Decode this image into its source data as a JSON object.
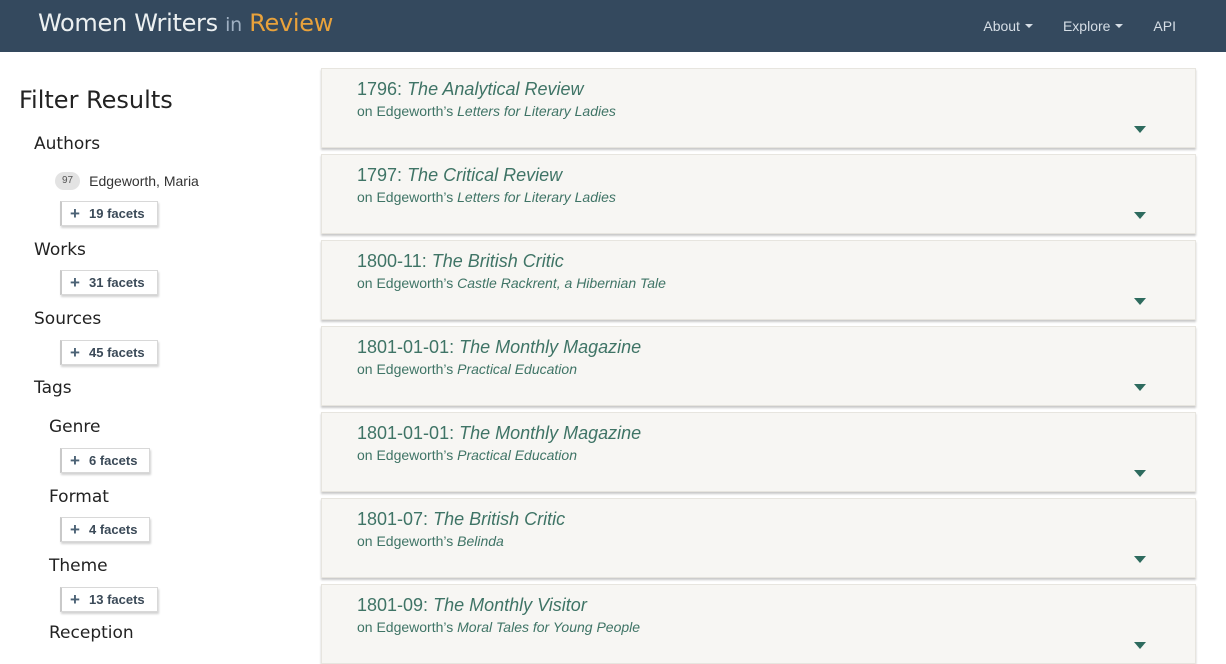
{
  "navbar": {
    "brand_part1": "Women Writers",
    "brand_part2": "in",
    "brand_part3": "Review",
    "links": [
      {
        "label": "About",
        "has_caret": true
      },
      {
        "label": "Explore",
        "has_caret": true
      },
      {
        "label": "API",
        "has_caret": false
      }
    ]
  },
  "sidebar": {
    "title": "Filter Results",
    "authors_label": "Authors",
    "author_entry": {
      "count": "97",
      "name": "Edgeworth, Maria"
    },
    "authors_facets": "19 facets",
    "works_label": "Works",
    "works_facets": "31 facets",
    "sources_label": "Sources",
    "sources_facets": "45 facets",
    "tags_label": "Tags",
    "genre_label": "Genre",
    "genre_facets": "6 facets",
    "format_label": "Format",
    "format_facets": "4 facets",
    "theme_label": "Theme",
    "theme_facets": "13 facets",
    "cutoff_label": "Reception"
  },
  "results": [
    {
      "date": "1796:",
      "venue": "The Analytical Review",
      "on": "on Edgeworth’s",
      "work": "Letters for Literary Ladies"
    },
    {
      "date": "1797:",
      "venue": "The Critical Review",
      "on": "on Edgeworth’s",
      "work": "Letters for Literary Ladies"
    },
    {
      "date": "1800-11:",
      "venue": "The British Critic",
      "on": "on Edgeworth’s",
      "work": "Castle Rackrent, a Hibernian Tale"
    },
    {
      "date": "1801-01-01:",
      "venue": "The Monthly Magazine",
      "on": "on Edgeworth’s",
      "work": "Practical Education"
    },
    {
      "date": "1801-01-01:",
      "venue": "The Monthly Magazine",
      "on": "on Edgeworth’s",
      "work": "Practical Education"
    },
    {
      "date": "1801-07:",
      "venue": "The British Critic",
      "on": "on Edgeworth’s",
      "work": "Belinda"
    },
    {
      "date": "1801-09:",
      "venue": "The Monthly Visitor",
      "on": "on Edgeworth’s",
      "work": "Moral Tales for Young People"
    }
  ],
  "colors": {
    "navbar_bg": "#34495e",
    "brand_accent": "#e9a23b",
    "card_bg": "#f7f6f3",
    "card_text": "#3f7466"
  },
  "icons": {
    "expand": "chevron-down-icon",
    "facet": "plus-icon"
  }
}
